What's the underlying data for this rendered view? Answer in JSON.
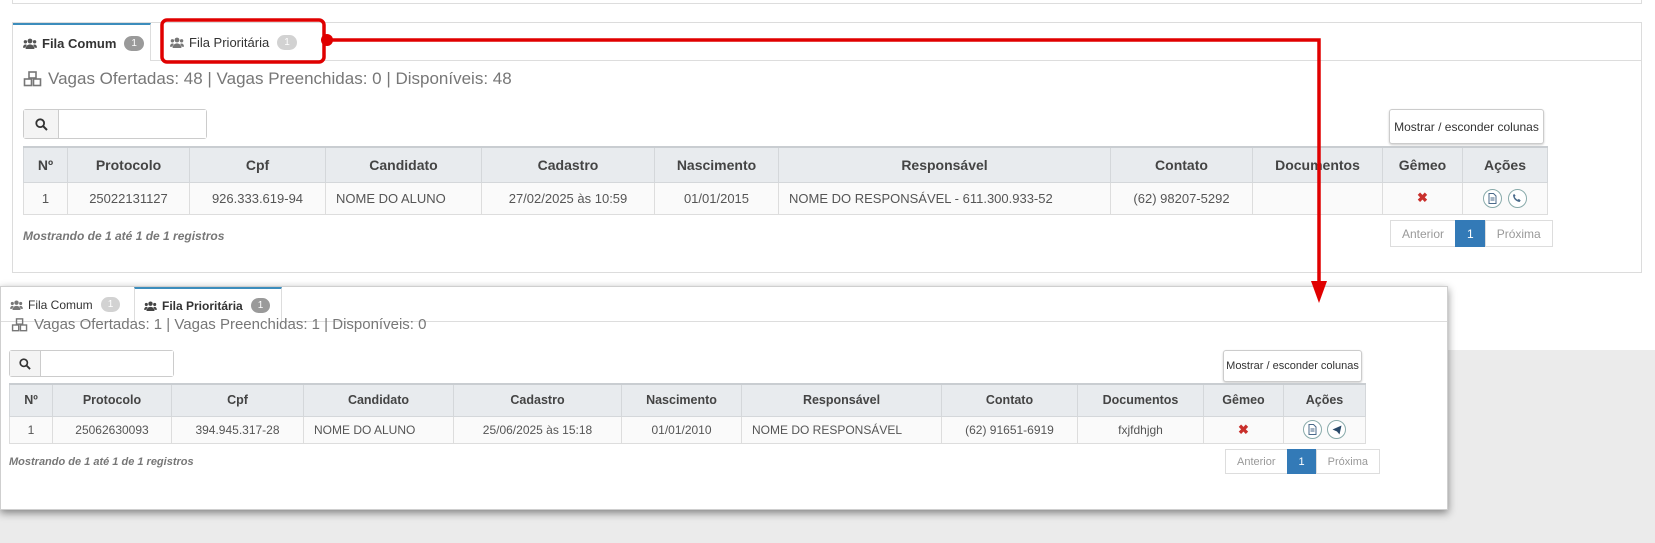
{
  "colors": {
    "accent": "#337ab7",
    "annotation": "#e00000",
    "danger": "#c9302c"
  },
  "panel1": {
    "tabs": [
      {
        "label": "Fila Comum",
        "badge": "1",
        "active": true
      },
      {
        "label": "Fila Prioritária",
        "badge": "1",
        "active": false
      }
    ],
    "summary": "Vagas Ofertadas: 48 | Vagas Preenchidas: 0 | Disponíveis: 48",
    "search_value": "",
    "columns_button": "Mostrar / esconder colunas",
    "headers": [
      "Nº",
      "Protocolo",
      "Cpf",
      "Candidato",
      "Cadastro",
      "Nascimento",
      "Responsável",
      "Contato",
      "Documentos",
      "Gêmeo",
      "Ações"
    ],
    "row": {
      "num": "1",
      "protocolo": "25022131127",
      "cpf": "926.333.619-94",
      "candidato": "NOME DO ALUNO",
      "cadastro": "27/02/2025 às 10:59",
      "nascimento": "01/01/2015",
      "responsavel": "NOME DO RESPONSÁVEL - 611.300.933-52",
      "contato": "(62) 98207-5292",
      "documentos": "",
      "gemeo": "✖"
    },
    "footer": "Mostrando de 1 até 1 de 1 registros",
    "pager": {
      "prev": "Anterior",
      "current": "1",
      "next": "Próxima"
    }
  },
  "panel2": {
    "tabs": [
      {
        "label": "Fila Comum",
        "badge": "1",
        "active": false
      },
      {
        "label": "Fila Prioritária",
        "badge": "1",
        "active": true
      }
    ],
    "summary": "Vagas Ofertadas: 1 | Vagas Preenchidas: 1 | Disponíveis: 0",
    "search_value": "",
    "columns_button": "Mostrar / esconder colunas",
    "headers": [
      "Nº",
      "Protocolo",
      "Cpf",
      "Candidato",
      "Cadastro",
      "Nascimento",
      "Responsável",
      "Contato",
      "Documentos",
      "Gêmeo",
      "Ações"
    ],
    "row": {
      "num": "1",
      "protocolo": "25062630093",
      "cpf": "394.945.317-28",
      "candidato": "NOME DO ALUNO",
      "cadastro": "25/06/2025 às 15:18",
      "nascimento": "01/01/2010",
      "responsavel": "NOME DO RESPONSÁVEL",
      "contato": "(62) 91651-6919",
      "documentos": "fxjfdhjgh",
      "gemeo": "✖"
    },
    "footer": "Mostrando de 1 até 1 de 1 registros",
    "pager": {
      "prev": "Anterior",
      "current": "1",
      "next": "Próxima"
    }
  }
}
